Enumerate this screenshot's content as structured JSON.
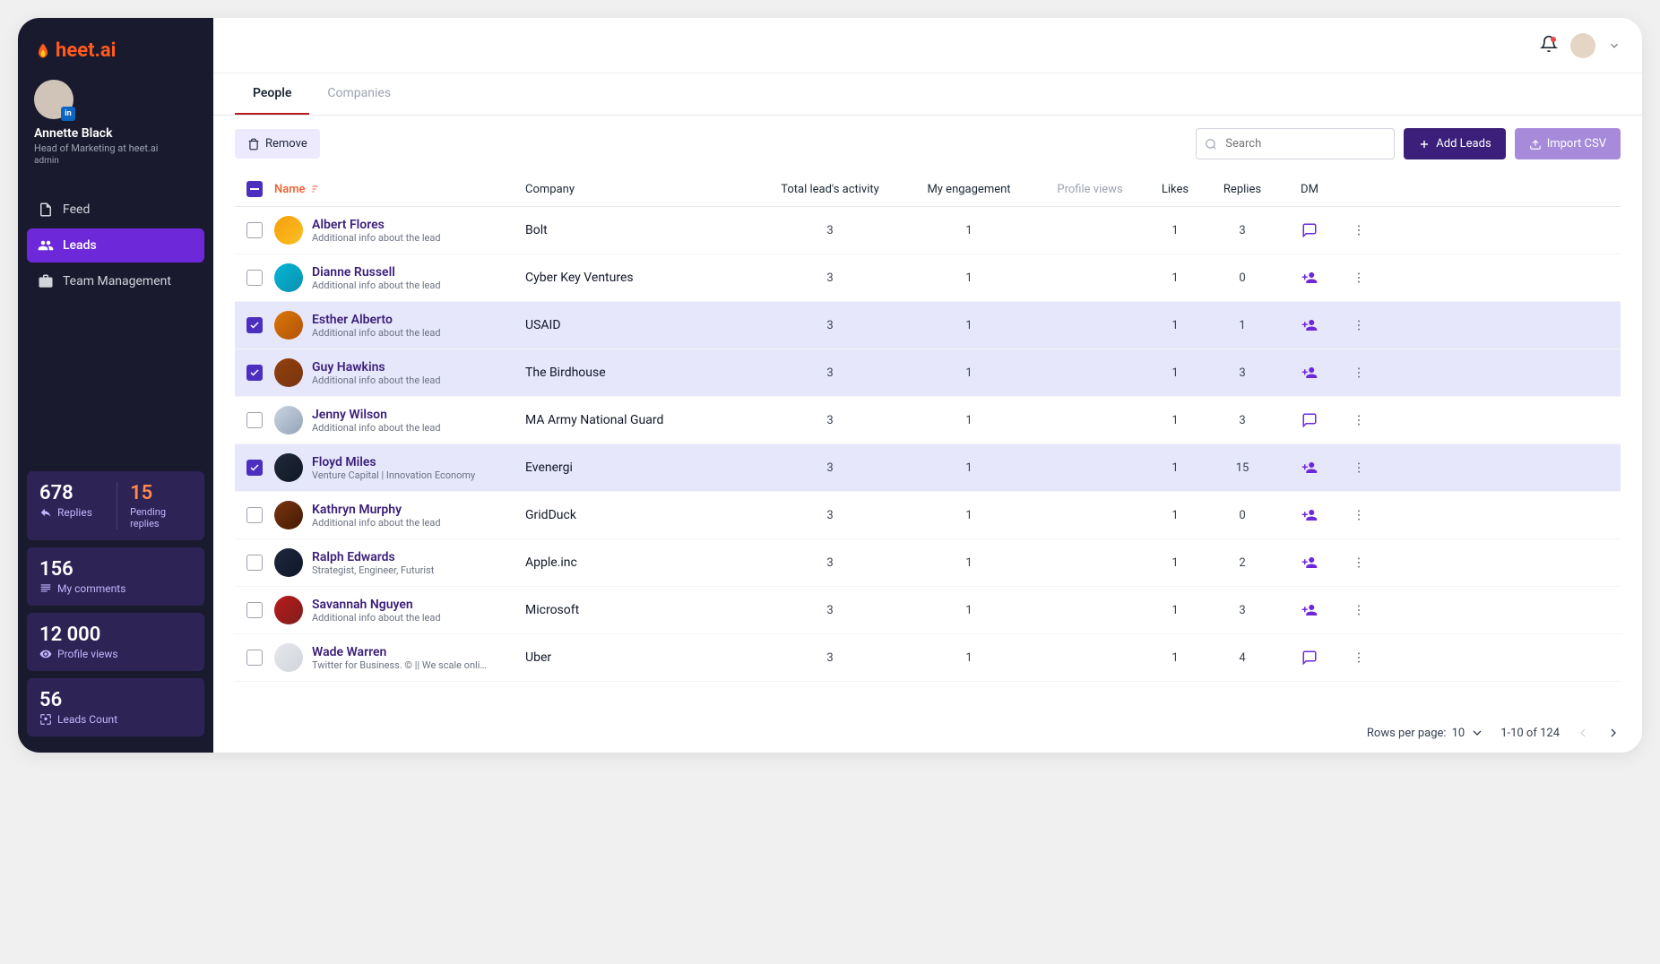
{
  "brand": {
    "name": "heet.ai"
  },
  "user": {
    "name": "Annette Black",
    "role": "Head of Marketing at heet.ai",
    "level": "admin"
  },
  "nav": {
    "feed": "Feed",
    "leads": "Leads",
    "team": "Team Management"
  },
  "stats": {
    "replies_count": "678",
    "replies_label": "Replies",
    "pending_count": "15",
    "pending_label": "Pending replies",
    "comments_count": "156",
    "comments_label": "My comments",
    "views_count": "12 000",
    "views_label": "Profile views",
    "leads_count": "56",
    "leads_label": "Leads  Count"
  },
  "tabs": {
    "people": "People",
    "companies": "Companies"
  },
  "toolbar": {
    "remove": "Remove",
    "search_placeholder": "Search",
    "add_leads": "Add Leads",
    "import_csv": "Import CSV"
  },
  "columns": {
    "name": "Name",
    "company": "Company",
    "activity": "Total lead's activity",
    "engagement": "My engagement",
    "profile_views": "Profile views",
    "likes": "Likes",
    "replies": "Replies",
    "dm": "DM"
  },
  "rows": [
    {
      "selected": false,
      "name": "Albert Flores",
      "sub": "Additional info about the lead",
      "company": "Bolt",
      "activity": "3",
      "engagement": "1",
      "views": "",
      "likes": "1",
      "replies": "3",
      "dm": "chat"
    },
    {
      "selected": false,
      "name": "Dianne Russell",
      "sub": "Additional info about the lead",
      "company": "Cyber Key Ventures",
      "activity": "3",
      "engagement": "1",
      "views": "",
      "likes": "1",
      "replies": "0",
      "dm": "add"
    },
    {
      "selected": true,
      "name": "Esther Alberto",
      "sub": "Additional info about the lead",
      "company": "USAID",
      "activity": "3",
      "engagement": "1",
      "views": "",
      "likes": "1",
      "replies": "1",
      "dm": "add"
    },
    {
      "selected": true,
      "name": "Guy Hawkins",
      "sub": "Additional info about the lead",
      "company": "The Birdhouse",
      "activity": "3",
      "engagement": "1",
      "views": "",
      "likes": "1",
      "replies": "3",
      "dm": "add"
    },
    {
      "selected": false,
      "name": "Jenny Wilson",
      "sub": "Additional info about the lead",
      "company": "MA Army National Guard",
      "activity": "3",
      "engagement": "1",
      "views": "",
      "likes": "1",
      "replies": "3",
      "dm": "chat"
    },
    {
      "selected": true,
      "name": "Floyd Miles",
      "sub": "Venture Capital | Innovation Economy",
      "company": "Evenergi",
      "activity": "3",
      "engagement": "1",
      "views": "",
      "likes": "1",
      "replies": "15",
      "dm": "add"
    },
    {
      "selected": false,
      "name": "Kathryn Murphy",
      "sub": "Additional info about the lead",
      "company": "GridDuck",
      "activity": "3",
      "engagement": "1",
      "views": "",
      "likes": "1",
      "replies": "0",
      "dm": "add"
    },
    {
      "selected": false,
      "name": "Ralph Edwards",
      "sub": "Strategist, Engineer, Futurist",
      "company": "Apple.inc",
      "activity": "3",
      "engagement": "1",
      "views": "",
      "likes": "1",
      "replies": "2",
      "dm": "add"
    },
    {
      "selected": false,
      "name": "Savannah Nguyen",
      "sub": "Additional info about the lead",
      "company": "Microsoft",
      "activity": "3",
      "engagement": "1",
      "views": "",
      "likes": "1",
      "replies": "3",
      "dm": "add"
    },
    {
      "selected": false,
      "name": "Wade Warren",
      "sub": "Twitter for Business. © || We scale online ed...",
      "company": "Uber",
      "activity": "3",
      "engagement": "1",
      "views": "",
      "likes": "1",
      "replies": "4",
      "dm": "chat"
    }
  ],
  "pagination": {
    "rows_label": "Rows per page:",
    "per_page": "10",
    "range": "1-10 of 124"
  }
}
